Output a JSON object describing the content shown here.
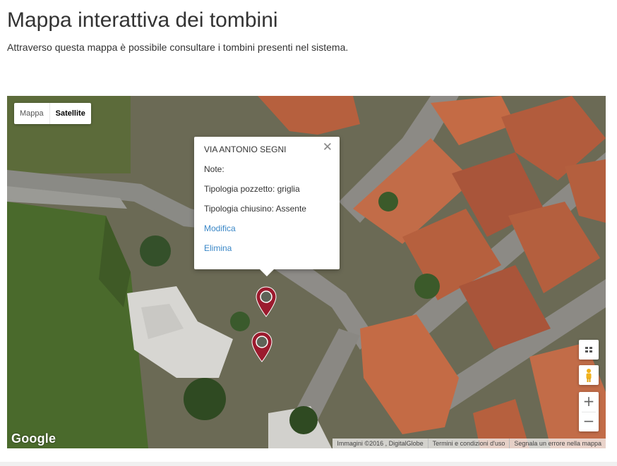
{
  "header": {
    "title": "Mappa interattiva dei tombini",
    "subtitle": "Attraverso questa mappa è possibile consultare i tombini presenti nel sistema."
  },
  "map": {
    "type_control": {
      "map_label": "Mappa",
      "satellite_label": "Satellite",
      "selected": "Satellite"
    },
    "infowindow": {
      "street": "VIA ANTONIO SEGNI",
      "close_icon": "close-icon",
      "note": "Note:",
      "tipologia_pozzetto": "Tipologia pozzetto: griglia",
      "tipologia_chiusino": "Tipologia chiusino: Assente",
      "edit_label": "Modifica",
      "delete_label": "Elimina"
    },
    "markers": [
      {
        "icon": "map-pin-icon",
        "color": "#9b1b2e"
      },
      {
        "icon": "map-pin-icon",
        "color": "#9b1b2e"
      }
    ],
    "controls": {
      "layers_icon": "grid-icon",
      "pegman_icon": "pegman-icon",
      "zoom_in": "+",
      "zoom_out": "−"
    },
    "google_logo": "Google",
    "attribution": {
      "imagery": "Immagini ©2016 , DigitalGlobe",
      "terms": "Termini e condizioni d'uso",
      "report": "Segnala un errore nella mappa"
    }
  },
  "colors": {
    "link": "#3a87c7",
    "marker": "#9b1b2e",
    "title": "#333333"
  }
}
